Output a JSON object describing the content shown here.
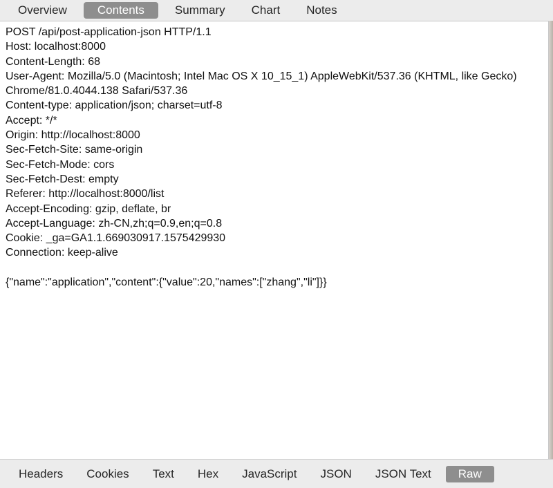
{
  "top_tabs": [
    {
      "label": "Overview",
      "active": false
    },
    {
      "label": "Contents",
      "active": true
    },
    {
      "label": "Summary",
      "active": false
    },
    {
      "label": "Chart",
      "active": false
    },
    {
      "label": "Notes",
      "active": false
    }
  ],
  "request_lines": [
    "POST /api/post-application-json HTTP/1.1",
    "Host: localhost:8000",
    "Content-Length: 68",
    "User-Agent: Mozilla/5.0 (Macintosh; Intel Mac OS X 10_15_1) AppleWebKit/537.36 (KHTML, like Gecko) Chrome/81.0.4044.138 Safari/537.36",
    "Content-type: application/json; charset=utf-8",
    "Accept: */*",
    "Origin: http://localhost:8000",
    "Sec-Fetch-Site: same-origin",
    "Sec-Fetch-Mode: cors",
    "Sec-Fetch-Dest: empty",
    "Referer: http://localhost:8000/list",
    "Accept-Encoding: gzip, deflate, br",
    "Accept-Language: zh-CN,zh;q=0.9,en;q=0.8",
    "Cookie: _ga=GA1.1.669030917.1575429930",
    "Connection: keep-alive",
    "",
    "{\"name\":\"application\",\"content\":{\"value\":20,\"names\":[\"zhang\",\"li\"]}}"
  ],
  "bottom_tabs": [
    {
      "label": "Headers",
      "active": false
    },
    {
      "label": "Cookies",
      "active": false
    },
    {
      "label": "Text",
      "active": false
    },
    {
      "label": "Hex",
      "active": false
    },
    {
      "label": "JavaScript",
      "active": false
    },
    {
      "label": "JSON",
      "active": false
    },
    {
      "label": "JSON Text",
      "active": false
    },
    {
      "label": "Raw",
      "active": true
    }
  ]
}
